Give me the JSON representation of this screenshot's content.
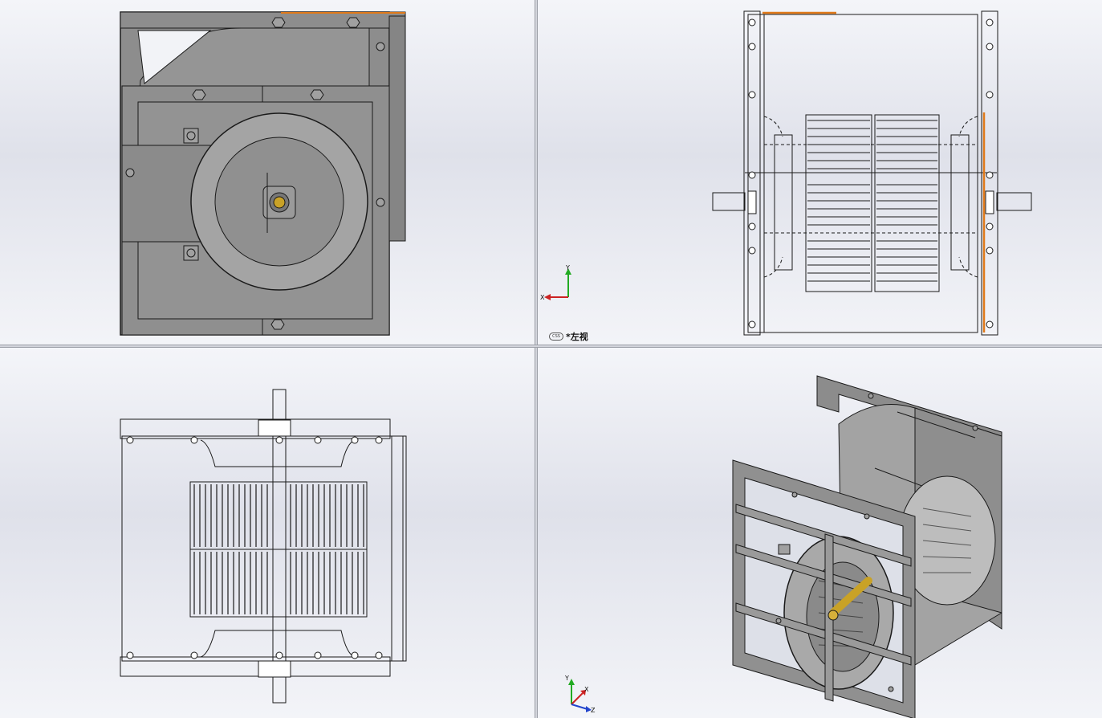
{
  "app": {
    "layout": "four-viewport",
    "colors": {
      "background_top": "#f4f5f9",
      "background_mid": "#dfe1ea",
      "steel": "#8f8f8f",
      "edge": "#1a1a1a",
      "highlight_edge": "#e07a1a",
      "shaft": "#c9a227",
      "axis_x": "#cc2222",
      "axis_y": "#22aa22",
      "axis_z": "#2244cc"
    }
  },
  "viewports": [
    {
      "id": "top-left",
      "model_view": "front-shaded",
      "icon": "centrifugal-fan-front-icon"
    },
    {
      "id": "top-right",
      "model_view": "left-wireframe",
      "label": "*左视",
      "label_badge": "CSS",
      "triad": {
        "x": "X",
        "y": "Y"
      }
    },
    {
      "id": "bottom-left",
      "model_view": "top-wireframe"
    },
    {
      "id": "bottom-right",
      "model_view": "isometric-shaded",
      "triad": {
        "x": "X",
        "y": "Y",
        "z": "Z"
      }
    }
  ]
}
